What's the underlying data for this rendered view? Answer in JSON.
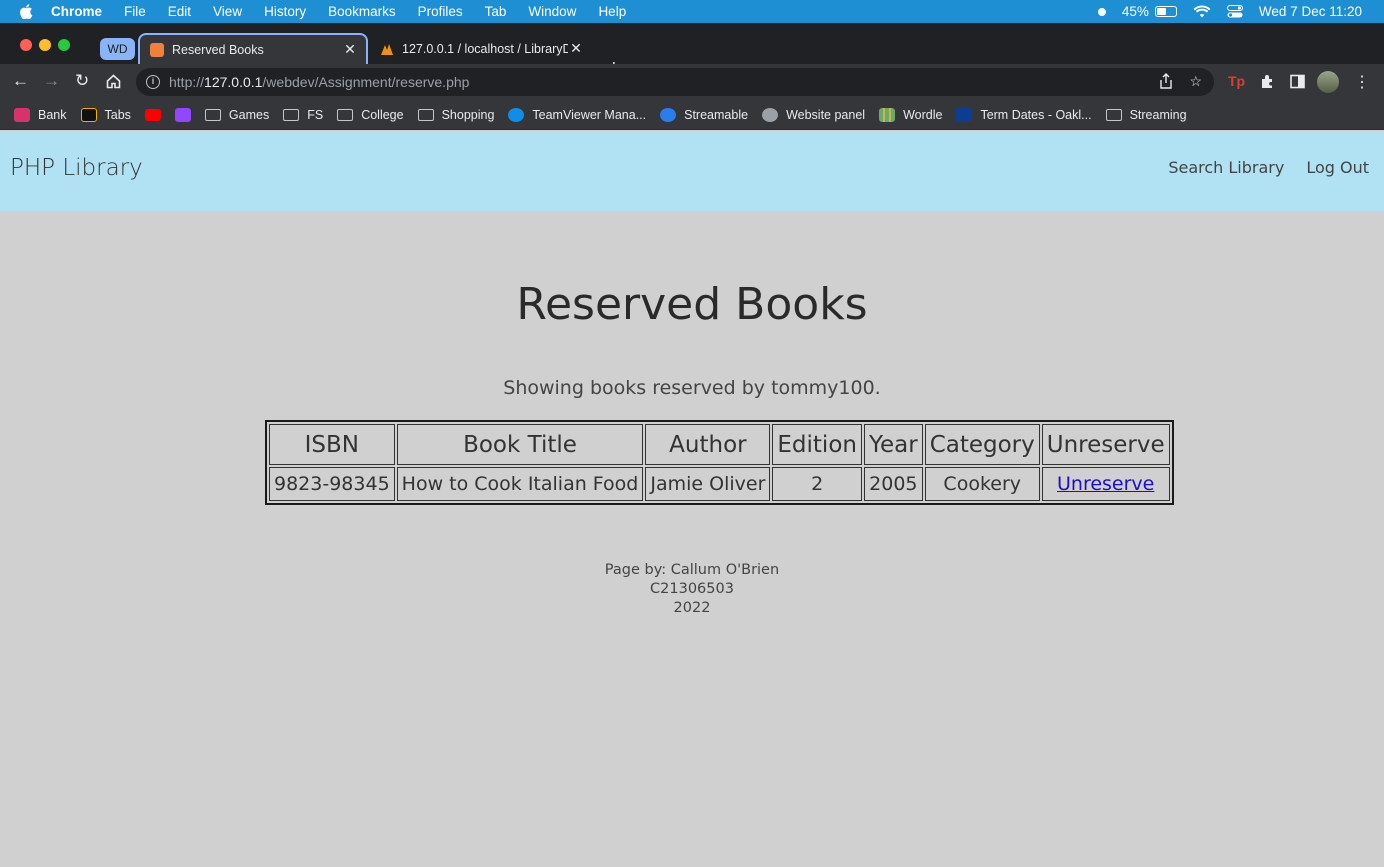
{
  "menubar": {
    "app_name": "Chrome",
    "menus": [
      "File",
      "Edit",
      "View",
      "History",
      "Bookmarks",
      "Profiles",
      "Tab",
      "Window",
      "Help"
    ],
    "battery_percent": "45%",
    "battery_level": 0.45,
    "clock": "Wed 7 Dec  11:20"
  },
  "browser": {
    "tab_group_label": "WD",
    "tabs": [
      {
        "title": "Reserved Books",
        "active": true
      },
      {
        "title": "127.0.0.1 / localhost / LibraryDB",
        "active": false
      }
    ],
    "url_host": "127.0.0.1",
    "url_prefix": "http://",
    "url_path": "/webdev/Assignment/reserve.php",
    "bookmarks": [
      "Bank",
      "Tabs",
      "",
      "",
      "Games",
      "FS",
      "College",
      "Shopping",
      "TeamViewer Mana...",
      "Streamable",
      "Website panel",
      "Wordle",
      "Term Dates - Oakl...",
      "Streaming"
    ]
  },
  "page": {
    "brand": "PHP Library",
    "nav": {
      "search": "Search Library",
      "logout": "Log Out"
    },
    "heading": "Reserved Books",
    "subtitle": "Showing books reserved by tommy100.",
    "table": {
      "headers": [
        "ISBN",
        "Book Title",
        "Author",
        "Edition",
        "Year",
        "Category",
        "Unreserve"
      ],
      "rows": [
        {
          "isbn": "9823-98345",
          "title": "How to Cook Italian Food",
          "author": "Jamie Oliver",
          "edition": "2",
          "year": "2005",
          "category": "Cookery",
          "action": "Unreserve"
        }
      ]
    },
    "footer": {
      "line1": "Page by: Callum O'Brien",
      "line2": "C21306503",
      "line3": "2022"
    }
  }
}
